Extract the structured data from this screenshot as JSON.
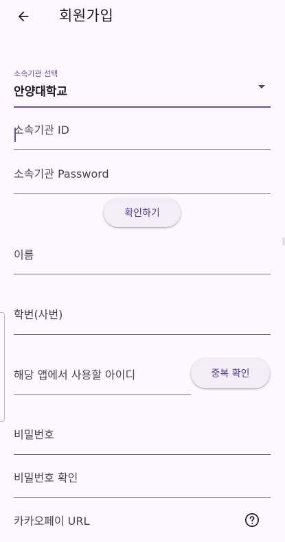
{
  "appbar": {
    "title": "회원가입",
    "back_icon": "arrow-back-icon"
  },
  "form": {
    "org_select": {
      "label": "소속기관 선택",
      "value": "안양대학교",
      "icon": "dropdown-arrow-icon"
    },
    "org_id": {
      "label": "소속기관 ID"
    },
    "org_password": {
      "label": "소속기관 Password"
    },
    "verify_button": "확인하기",
    "name": {
      "label": "이름"
    },
    "student_id": {
      "label": "학번(사번)"
    },
    "app_id": {
      "label": "해당 앱에서 사용할 아이디"
    },
    "duplicate_check_button": "중복 확인",
    "password": {
      "label": "비밀번호"
    },
    "password_confirm": {
      "label": "비밀번호 확인"
    },
    "kakaopay_url": {
      "label": "카카오페이 URL",
      "help_icon": "help-circle-icon"
    }
  },
  "colors": {
    "background": "#fdf7ff",
    "accent": "#6750a4",
    "button_bg": "#f3edf7",
    "button_text": "#4f3f8f"
  }
}
